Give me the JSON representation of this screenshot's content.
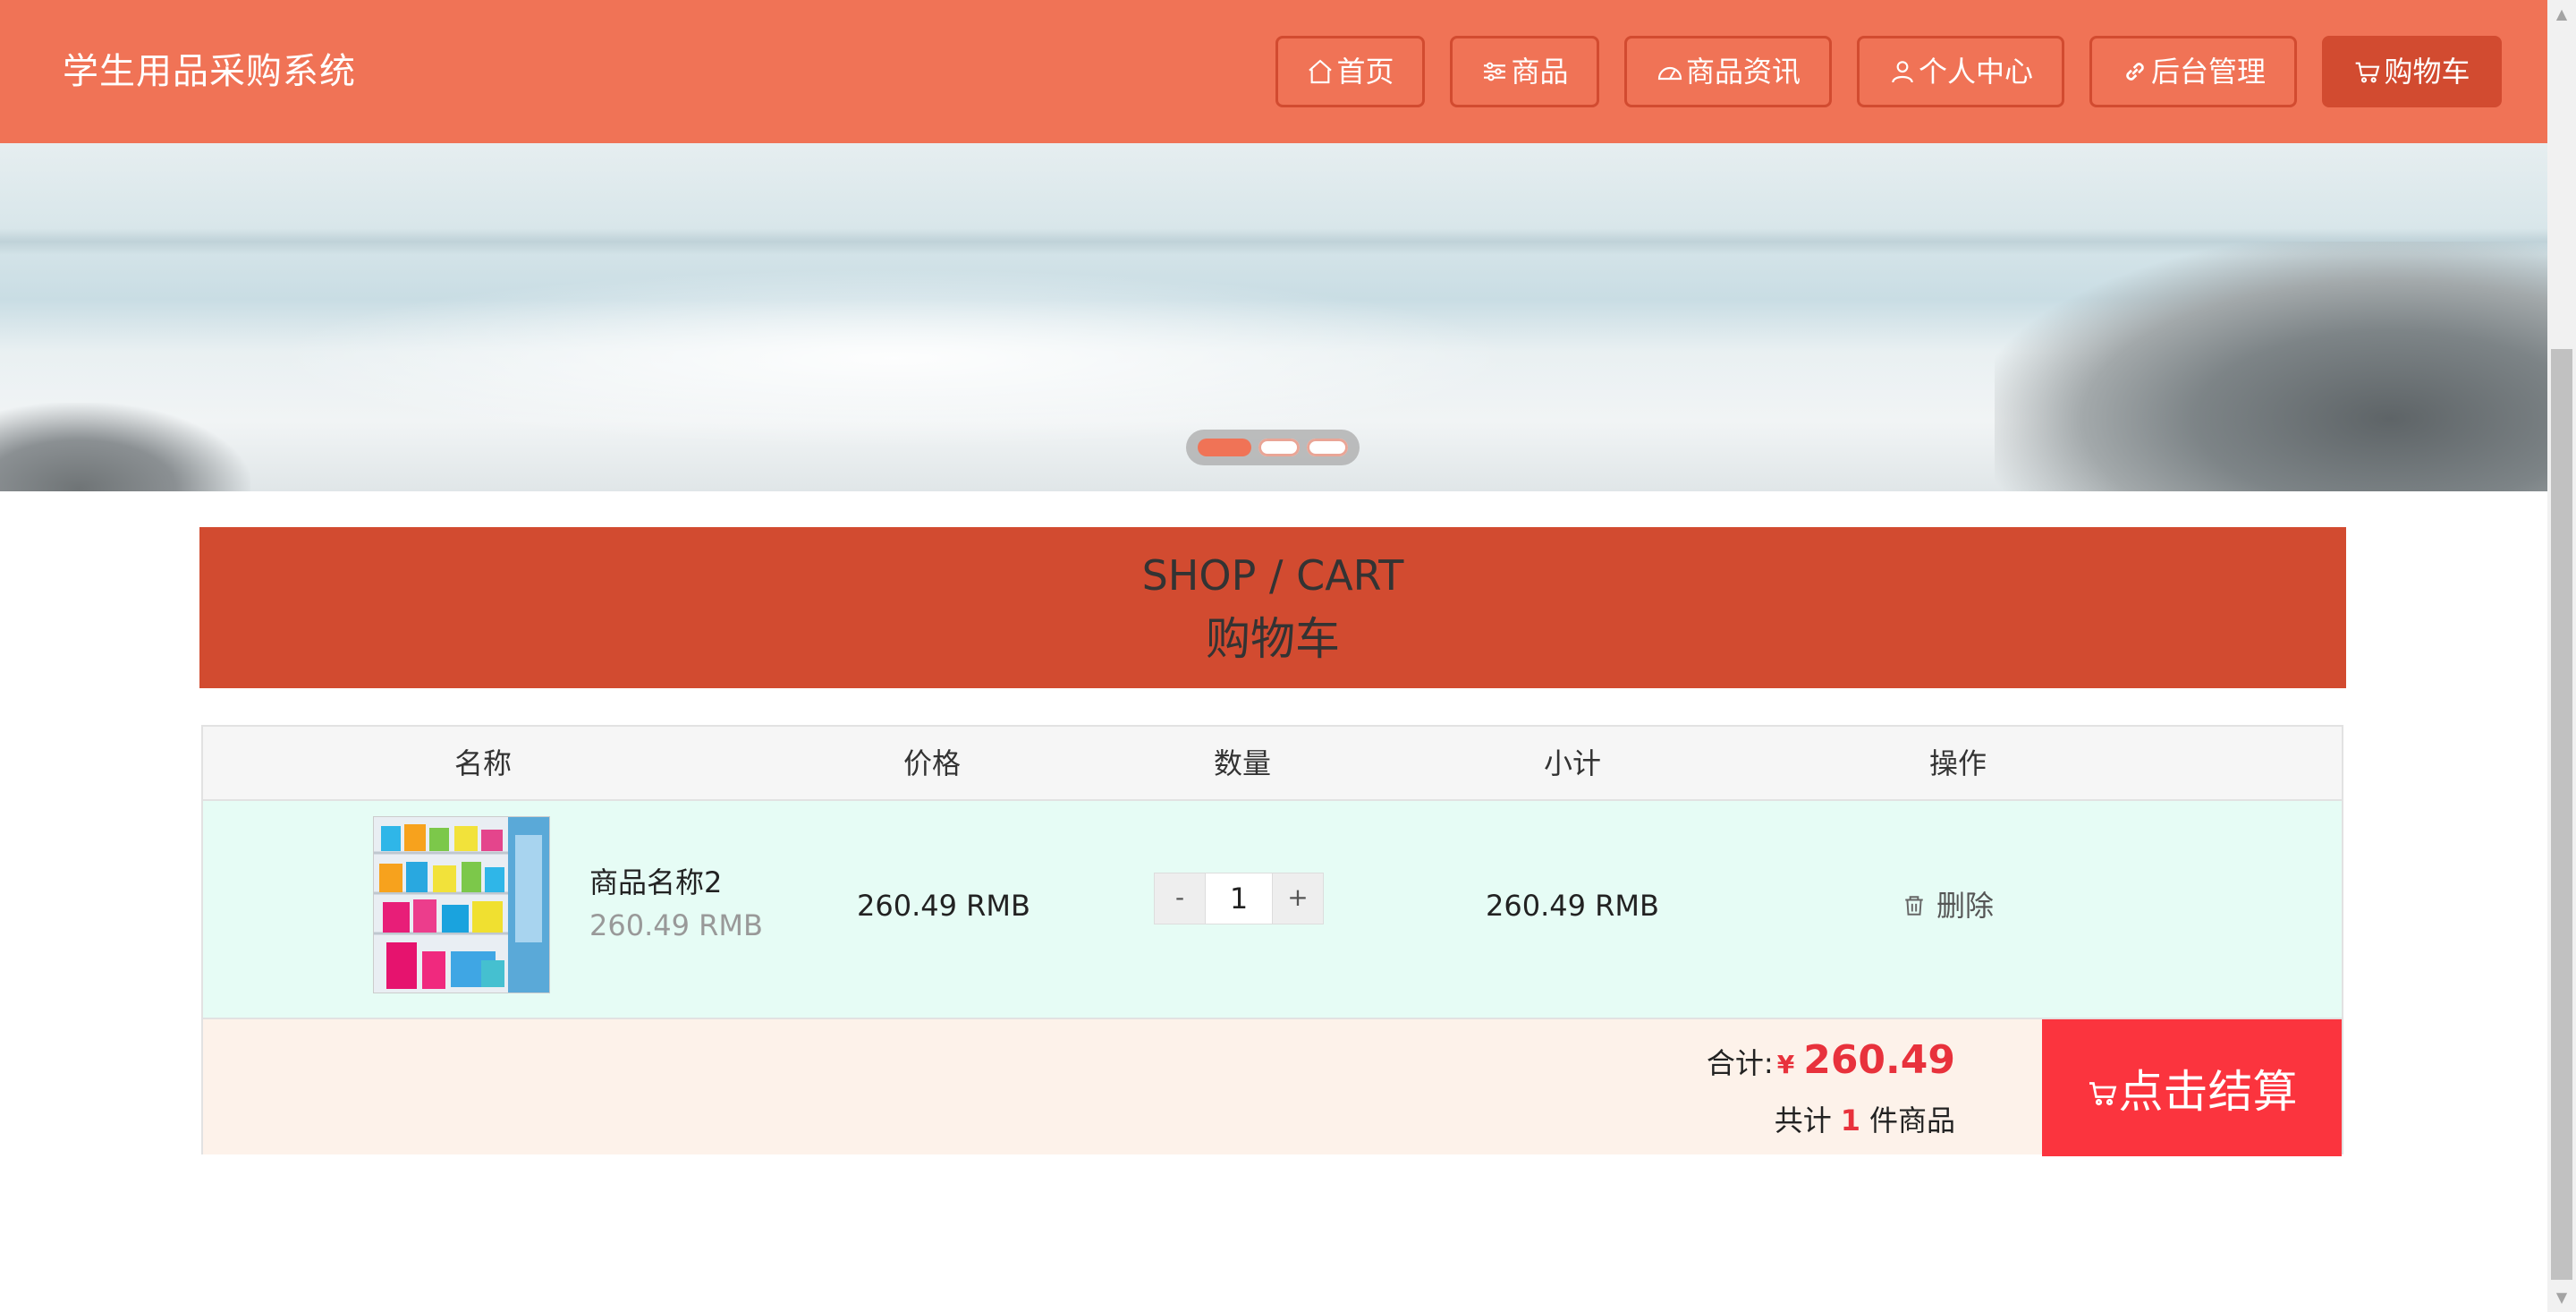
{
  "header": {
    "title": "学生用品采购系统",
    "nav": [
      {
        "label": "首页",
        "icon": "home-icon"
      },
      {
        "label": "商品",
        "icon": "sliders-icon"
      },
      {
        "label": "商品资讯",
        "icon": "dashboard-icon"
      },
      {
        "label": "个人中心",
        "icon": "user-icon"
      },
      {
        "label": "后台管理",
        "icon": "link-icon"
      },
      {
        "label": "购物车",
        "icon": "cart-icon",
        "active": true
      }
    ],
    "colors": {
      "bar": "#f07356",
      "accent": "#d24b30"
    }
  },
  "carousel": {
    "slides": 3,
    "active_index": 0
  },
  "page_title": {
    "en": "SHOP / CART",
    "cn": "购物车"
  },
  "cart": {
    "columns": [
      "名称",
      "价格",
      "数量",
      "小计",
      "操作"
    ],
    "items": [
      {
        "name": "商品名称2",
        "sub_price": "260.49 RMB",
        "price": "260.49 RMB",
        "quantity": "1",
        "subtotal": "260.49 RMB",
        "action": "删除"
      }
    ],
    "stepper": {
      "minus": "-",
      "plus": "+"
    },
    "summary": {
      "total_label": "合计:",
      "currency": "¥",
      "total": "260.49",
      "count_prefix": "共计",
      "count": "1",
      "count_suffix": "件商品"
    },
    "checkout_label": "点击结算",
    "colors": {
      "row": "#e6fcf5",
      "footer": "#fdf2ea",
      "highlight": "#e8323c",
      "checkout": "#fb343e"
    }
  }
}
